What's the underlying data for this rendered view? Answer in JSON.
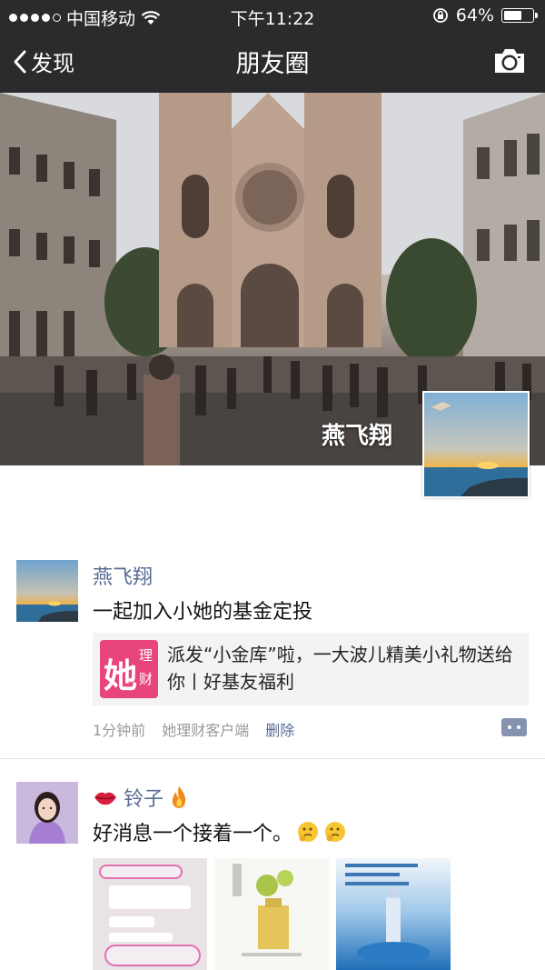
{
  "status_bar": {
    "carrier": "中国移动",
    "time": "下午11:22",
    "battery": "64%",
    "battery_level": 0.64
  },
  "nav": {
    "back_label": "发现",
    "title": "朋友圈",
    "camera_icon": "camera-icon"
  },
  "cover": {
    "owner_name": "燕飞翔"
  },
  "posts": [
    {
      "name": "燕飞翔",
      "text": "一起加入小她的基金定投",
      "share": {
        "logo_big": "她",
        "logo_small_1": "理",
        "logo_small_2": "财",
        "text": "派发“小金库”啦，一大波儿精美小礼物送给你丨好基友福利"
      },
      "time": "1分钟前",
      "source": "她理财客户端",
      "delete_label": "删除"
    },
    {
      "name": "铃子",
      "text": "好消息一个接着一个。"
    }
  ],
  "colors": {
    "nav_bg": "#2b2b2e",
    "link": "#576b95",
    "share_bg": "#f3f3f5",
    "brand_pink": "#e8457a"
  }
}
